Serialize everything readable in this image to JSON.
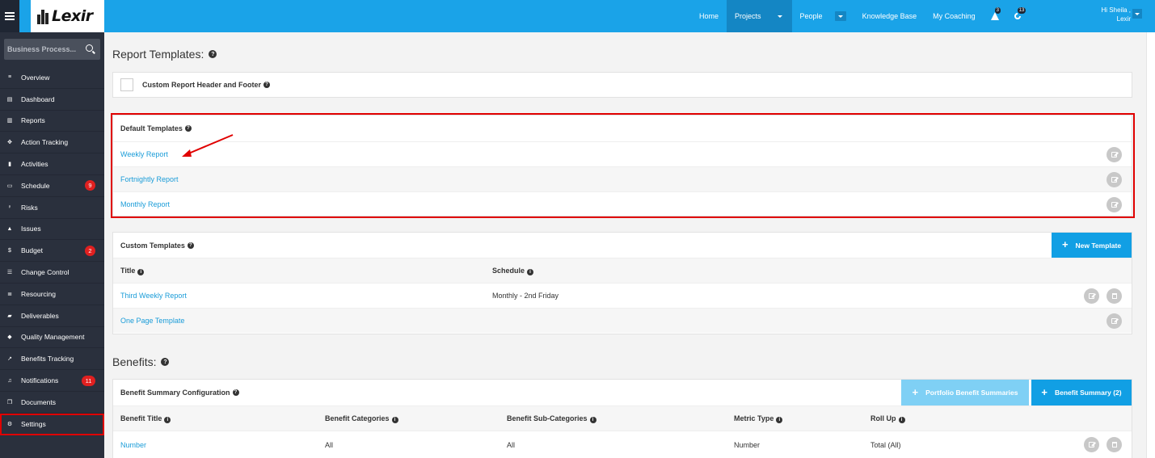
{
  "topbar": {
    "logo_text": "Lexir",
    "nav": {
      "home": "Home",
      "projects": "Projects",
      "people": "People",
      "knowledge_base": "Knowledge Base",
      "my_coaching": "My Coaching"
    },
    "alerts_count": "3",
    "updates_count": "13",
    "user_greeting": "Hi Sheila ,",
    "user_org": "Lexir"
  },
  "sidebar": {
    "search_placeholder": "Business Process...",
    "items": [
      {
        "label": "Overview",
        "icon": "list-icon"
      },
      {
        "label": "Dashboard",
        "icon": "dashboard-icon"
      },
      {
        "label": "Reports",
        "icon": "bar-chart-icon"
      },
      {
        "label": "Action Tracking",
        "icon": "crosshair-icon"
      },
      {
        "label": "Activities",
        "icon": "bookmark-icon"
      },
      {
        "label": "Schedule",
        "icon": "calendar-icon",
        "count": "9"
      },
      {
        "label": "Risks",
        "icon": "lightbulb-icon"
      },
      {
        "label": "Issues",
        "icon": "warning-icon"
      },
      {
        "label": "Budget",
        "icon": "dollar-icon",
        "count": "2"
      },
      {
        "label": "Change Control",
        "icon": "layers-icon"
      },
      {
        "label": "Resourcing",
        "icon": "stack-icon"
      },
      {
        "label": "Deliverables",
        "icon": "truck-icon"
      },
      {
        "label": "Quality Management",
        "icon": "tag-icon"
      },
      {
        "label": "Benefits Tracking",
        "icon": "line-chart-icon"
      },
      {
        "label": "Notifications",
        "icon": "bell-icon",
        "count": "11"
      },
      {
        "label": "Documents",
        "icon": "documents-icon"
      },
      {
        "label": "Settings",
        "icon": "gears-icon"
      }
    ]
  },
  "report_templates": {
    "heading": "Report Templates:",
    "custom_header_footer_label": "Custom Report Header and Footer",
    "default_templates": {
      "title": "Default Templates",
      "items": [
        "Weekly Report",
        "Fortnightly Report",
        "Monthly Report"
      ]
    },
    "custom_templates": {
      "title": "Custom Templates",
      "new_button": "New Template",
      "columns": [
        "Title",
        "Schedule"
      ],
      "rows": [
        {
          "title": "Third Weekly Report",
          "schedule": "Monthly - 2nd Friday"
        },
        {
          "title": "One Page Template",
          "schedule": ""
        }
      ]
    }
  },
  "benefits": {
    "heading": "Benefits:",
    "config_title": "Benefit Summary Configuration",
    "portfolio_button": "Portfolio Benefit Summaries",
    "summary_button": "Benefit Summary (2)",
    "columns": [
      "Benefit Title",
      "Benefit Categories",
      "Benefit Sub-Categories",
      "Metric Type",
      "Roll Up"
    ],
    "rows": [
      {
        "title": "Number",
        "categories": "All",
        "sub_categories": "All",
        "metric_type": "Number",
        "roll_up": "Total (All)"
      }
    ]
  },
  "colors": {
    "topbar": "#1aa3e8",
    "sidebar": "#2a303d",
    "link": "#1a9cd8",
    "highlight": "#e00000"
  }
}
